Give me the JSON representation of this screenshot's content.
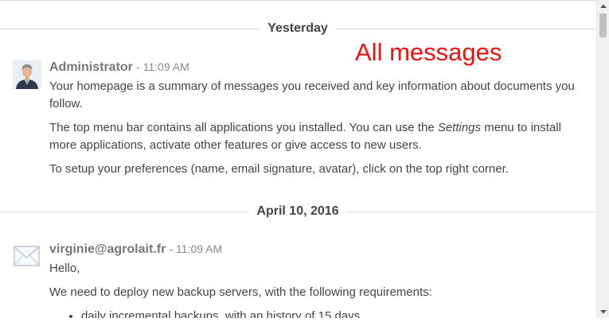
{
  "annotation": "All messages",
  "separators": {
    "first": "Yesterday",
    "second": "April 10, 2016"
  },
  "messages": [
    {
      "author": "Administrator",
      "time": "- 11:09 AM",
      "avatar_icon": "user-photo-icon",
      "paragraphs": [
        "Your homepage is a summary of messages you received and key information about documents you follow.",
        "The top menu bar contains all applications you installed. You can use the",
        "Settings",
        "menu to install more applications, activate other features or give access to new users.",
        "To setup your preferences (name, email signature, avatar), click on the top right corner."
      ]
    },
    {
      "author": "virginie@agrolait.fr",
      "time": "- 11:09 AM",
      "avatar_icon": "envelope-icon",
      "paragraphs": [
        "Hello,",
        "We need to deploy new backup servers, with the following requirements:"
      ],
      "list": [
        "daily incremental backups, with an history of 15 days"
      ]
    }
  ],
  "scrollbar": {
    "up_icon": "scroll-up-arrow-icon",
    "down_icon": "scroll-down-arrow-icon"
  }
}
